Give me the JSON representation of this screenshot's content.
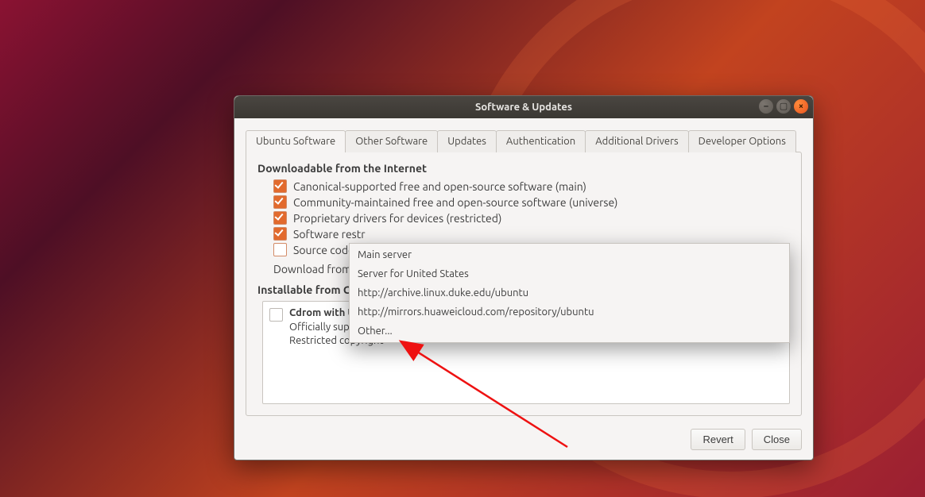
{
  "window": {
    "title": "Software & Updates"
  },
  "tabs": {
    "ubuntu": "Ubuntu Software",
    "other": "Other Software",
    "updates": "Updates",
    "auth": "Authentication",
    "drivers": "Additional Drivers",
    "dev": "Developer Options"
  },
  "section": {
    "downloadable_header": "Downloadable from the Internet",
    "installable_header": "Installable from CD-ROM/DVD"
  },
  "checks": {
    "main": "Canonical-supported free and open-source software (main)",
    "universe": "Community-maintained free and open-source software (universe)",
    "restricted": "Proprietary drivers for devices (restricted)",
    "multiverse_partial": "Software restr",
    "source": "Source code"
  },
  "download_from_label": "Download from:",
  "menu": {
    "main_server": "Main server",
    "us_server": "Server for United States",
    "mirror1": "http://archive.linux.duke.edu/ubuntu",
    "mirror2": "http://mirrors.huaweicloud.com/repository/ubuntu",
    "other": "Other..."
  },
  "cdrom": {
    "title": "Cdrom with Ubuntu 18.04 'Bionic Beaver'",
    "line2": "Officially supported",
    "line3": "Restricted copyright"
  },
  "buttons": {
    "revert": "Revert",
    "close": "Close"
  }
}
